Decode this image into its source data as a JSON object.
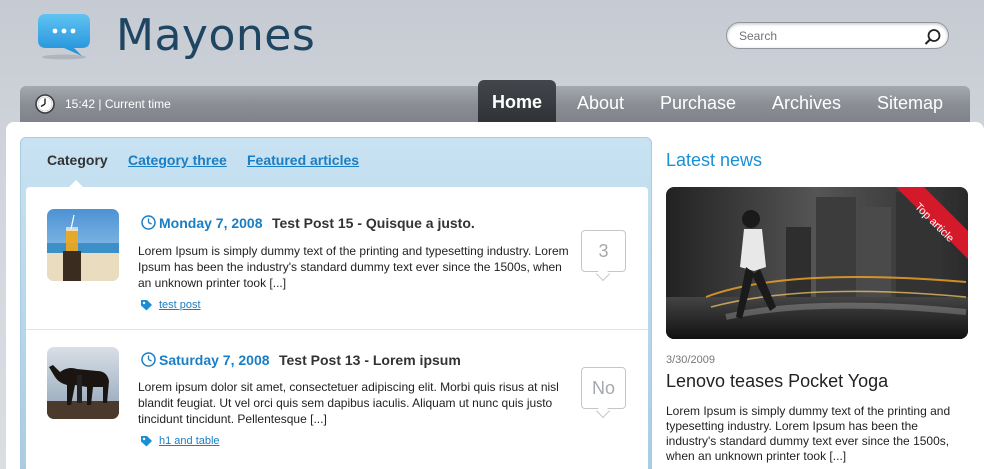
{
  "header": {
    "site_name": "Mayones",
    "search_placeholder": "Search"
  },
  "navbar": {
    "time_text": "15:42 | Current time",
    "items": [
      {
        "label": "Home",
        "active": true
      },
      {
        "label": "About"
      },
      {
        "label": "Purchase"
      },
      {
        "label": "Archives"
      },
      {
        "label": "Sitemap"
      }
    ]
  },
  "category_tabs": [
    {
      "label": "Category",
      "active": true
    },
    {
      "label": "Category three"
    },
    {
      "label": "Featured articles"
    }
  ],
  "posts": [
    {
      "date": "Monday 7, 2008",
      "title": "Test Post 15 - Quisque a justo.",
      "excerpt": "Lorem Ipsum is simply dummy text of the printing and typesetting industry. Lorem Ipsum has been the industry's standard dummy text ever since the 1500s, when an unknown printer took [...]",
      "tag": "test post",
      "comments": "3"
    },
    {
      "date": "Saturday 7, 2008",
      "title": "Test Post 13 - Lorem ipsum",
      "excerpt": "Lorem ipsum dolor sit amet, consectetuer adipiscing elit. Morbi quis risus at nisl blandit feugiat. Ut vel orci quis sem dapibus iaculis. Aliquam ut nunc quis justo tincidunt tincidunt. Pellentesque [...]",
      "tag": "h1 and table",
      "comments": "No"
    }
  ],
  "latest_news": {
    "heading": "Latest news",
    "ribbon": "Top article",
    "date": "3/30/2009",
    "title": "Lenovo teases Pocket Yoga",
    "excerpt": "Lorem Ipsum is simply dummy text of the printing and typesetting industry. Lorem Ipsum has been the industry's standard dummy text ever since the 1500s, when an unknown printer took [...]"
  },
  "colors": {
    "link_blue": "#1a7ec4",
    "heading_blue": "#1a8fd6",
    "nav_active_bg": "#2d3034",
    "ribbon_red": "#d41a2a",
    "logo_blue": "#1e4561"
  },
  "icons": [
    "speech-bubble-logo-icon",
    "search-icon",
    "clock-icon",
    "calendar-clock-icon",
    "tag-icon"
  ]
}
